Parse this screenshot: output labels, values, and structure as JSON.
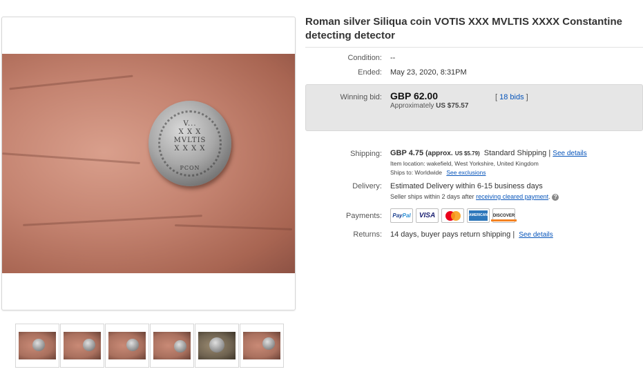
{
  "listing": {
    "title": "Roman silver Siliqua coin VOTIS XXX MVLTIS XXXX Constantine detecting detector"
  },
  "image": {
    "coin_inscription": [
      "V...",
      "X X X",
      "MVLTIS",
      "X X X X",
      "PCON"
    ],
    "thumbnails": [
      {
        "name": "thumbnail-1",
        "tone": "skin"
      },
      {
        "name": "thumbnail-2",
        "tone": "skin"
      },
      {
        "name": "thumbnail-3",
        "tone": "skin"
      },
      {
        "name": "thumbnail-4",
        "tone": "skin"
      },
      {
        "name": "thumbnail-5",
        "tone": "dark"
      },
      {
        "name": "thumbnail-6",
        "tone": "skin"
      }
    ]
  },
  "details": {
    "condition_label": "Condition:",
    "condition_value": "--",
    "ended_label": "Ended:",
    "ended_value": "May 23, 2020, 8:31PM",
    "winning_bid_label": "Winning bid:",
    "winning_bid_value": "GBP 62.00",
    "approx_prefix": "Approximately",
    "approx_value": "US $75.57",
    "bids_open": "[",
    "bids_link": "18 bids",
    "bids_close": "]",
    "shipping_label": "Shipping:",
    "shipping_cost": "GBP 4.75",
    "shipping_approx": "(approx.",
    "shipping_approx_value": "US $5.79)",
    "shipping_service": "Standard Shipping |",
    "see_details": "See details",
    "item_location": "Item location:  wakefield, West Yorkshire, United Kingdom",
    "ships_to": "Ships to:  Worldwide",
    "see_exclusions": "See exclusions",
    "delivery_label": "Delivery:",
    "delivery_value": "Estimated Delivery within 6-15 business days",
    "seller_ships": "Seller ships within 2 days after",
    "receiving_cleared_payment": "receiving cleared payment",
    "payments_label": "Payments:",
    "payment_methods": [
      "PayPal",
      "VISA",
      "Mastercard",
      "American Express",
      "DISCOVER"
    ],
    "paypal_pay": "Pay",
    "paypal_pal": "Pal",
    "visa_text": "VISA",
    "amex_text": "AMERICAN EXPRESS",
    "discover_text": "DISCOVER",
    "returns_label": "Returns:",
    "returns_value": "14 days, buyer pays return shipping |",
    "returns_see_details": "See details"
  },
  "colors": {
    "link": "#0654ba",
    "panel_bg": "#e6e6e6",
    "title_text": "#333333"
  }
}
